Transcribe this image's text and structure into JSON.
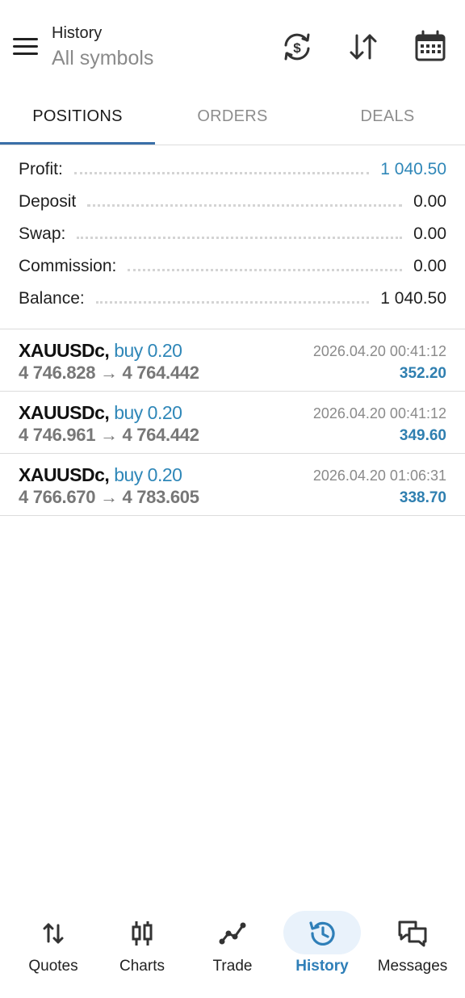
{
  "header": {
    "title": "History",
    "subtitle": "All symbols",
    "icons": [
      "currency-sync-icon",
      "sort-icon",
      "calendar-icon"
    ]
  },
  "tabs": [
    {
      "label": "POSITIONS",
      "active": true
    },
    {
      "label": "ORDERS",
      "active": false
    },
    {
      "label": "DEALS",
      "active": false
    }
  ],
  "summary": [
    {
      "label": "Profit:",
      "value": "1 040.50",
      "highlight": true
    },
    {
      "label": "Deposit",
      "value": "0.00",
      "highlight": false
    },
    {
      "label": "Swap:",
      "value": "0.00",
      "highlight": false
    },
    {
      "label": "Commission:",
      "value": "0.00",
      "highlight": false
    },
    {
      "label": "Balance:",
      "value": "1 040.50",
      "highlight": false
    }
  ],
  "positions": [
    {
      "symbol": "XAUUSDc,",
      "side": "buy 0.20",
      "prices": "4 746.828 → 4 764.442",
      "time": "2026.04.20 00:41:12",
      "profit": "352.20"
    },
    {
      "symbol": "XAUUSDc,",
      "side": "buy 0.20",
      "prices": "4 746.961 → 4 764.442",
      "time": "2026.04.20 00:41:12",
      "profit": "349.60"
    },
    {
      "symbol": "XAUUSDc,",
      "side": "buy 0.20",
      "prices": "4 766.670 → 4 783.605",
      "time": "2026.04.20 01:06:31",
      "profit": "338.70"
    }
  ],
  "nav": [
    {
      "label": "Quotes",
      "icon": "quotes-icon",
      "active": false
    },
    {
      "label": "Charts",
      "icon": "charts-icon",
      "active": false
    },
    {
      "label": "Trade",
      "icon": "trade-icon",
      "active": false
    },
    {
      "label": "History",
      "icon": "history-icon",
      "active": true
    },
    {
      "label": "Messages",
      "icon": "messages-icon",
      "active": false
    }
  ],
  "colors": {
    "accent": "#2f87b8",
    "tab_underline": "#3a6fa8",
    "active_pill": "#e9f2fb"
  }
}
